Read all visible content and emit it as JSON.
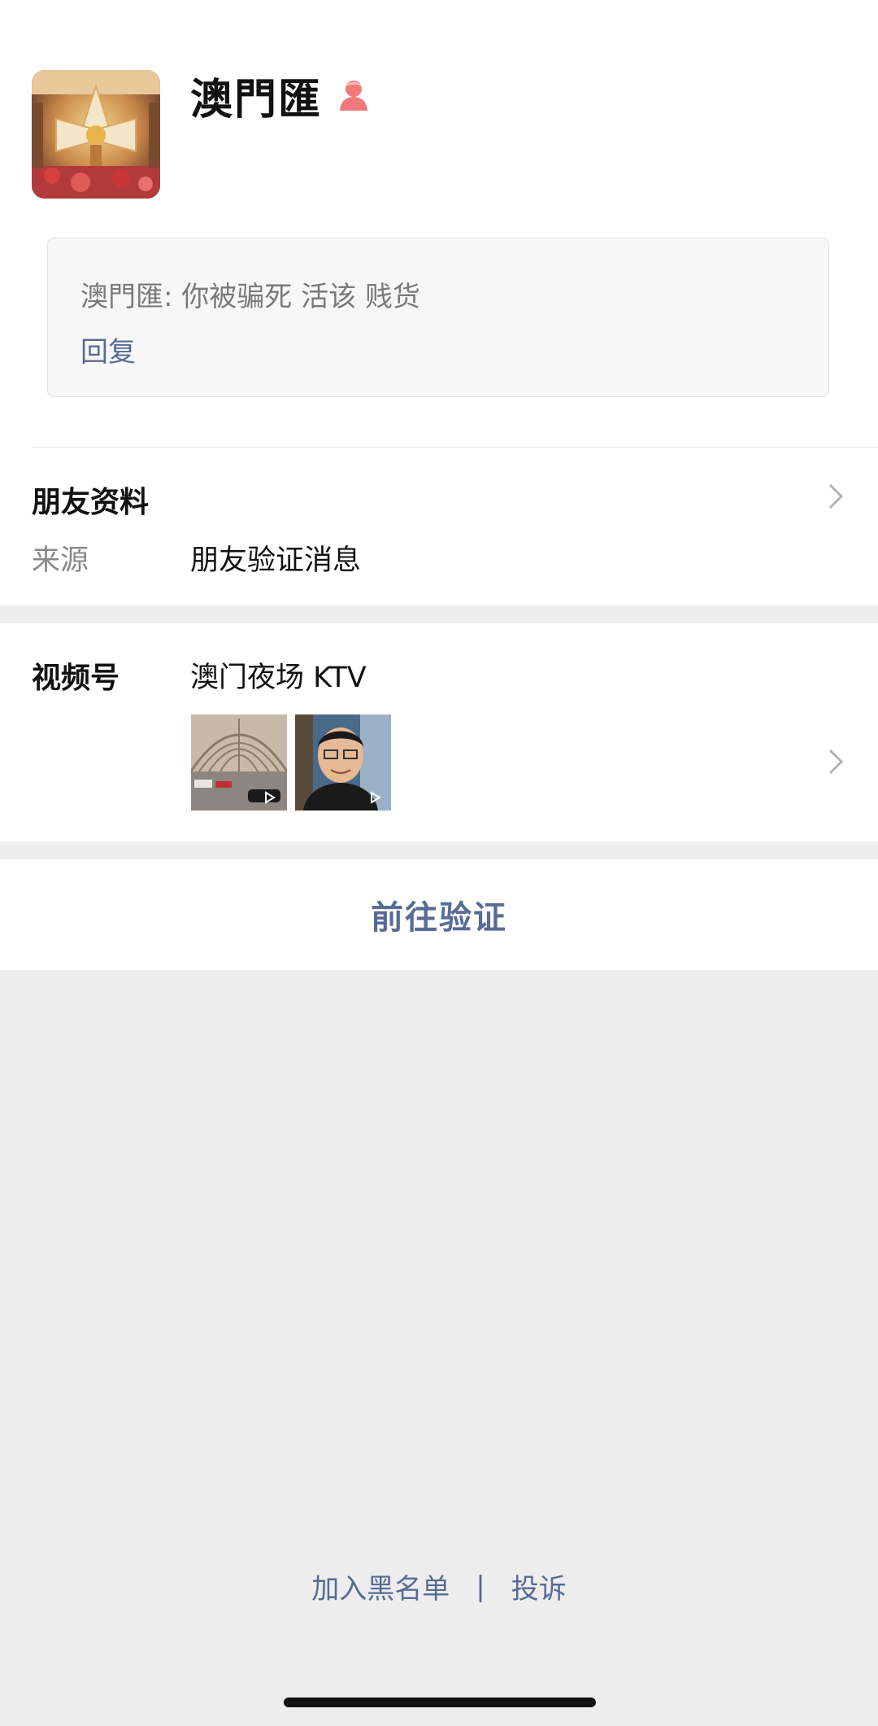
{
  "profile": {
    "name": "澳門匯",
    "gender_icon": "female-user-icon",
    "avatar_icon": "profile-avatar-image"
  },
  "message": {
    "text": "澳門匯: 你被骗死 活该 贱货",
    "reply_label": "回复"
  },
  "friend_info": {
    "title": "朋友资料",
    "source_label": "来源",
    "source_value": "朋友验证消息"
  },
  "channels": {
    "label": "视频号",
    "name": "澳门夜场 KTV",
    "thumbnails": [
      "video-thumbnail-arcade",
      "video-thumbnail-selfie"
    ]
  },
  "actions": {
    "verify_label": "前往验证",
    "blacklist_label": "加入黑名单",
    "separator": "|",
    "report_label": "投诉"
  },
  "colors": {
    "link": "#576b95",
    "background": "#ededed",
    "gender_icon": "#f07a7a"
  }
}
